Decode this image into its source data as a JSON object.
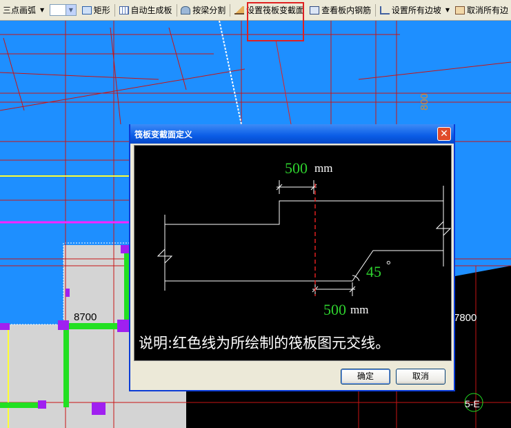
{
  "toolbar": {
    "arc_label": "三点画弧",
    "rect_label": "矩形",
    "auto_slab_label": "自动生成板",
    "split_beam_label": "按梁分割",
    "set_variable_section_label": "设置筏板变截面",
    "view_rebar_label": "查看板内钢筋",
    "set_all_slopes_label": "设置所有边坡",
    "cancel_all_label": "取消所有边"
  },
  "canvas": {
    "dim_left": "8700",
    "dim_right": "7800",
    "dim_top": "800",
    "axis_label": "5-E"
  },
  "dialog": {
    "title": "筏板变截面定义",
    "dim_top_value": "500",
    "dim_top_unit": "mm",
    "angle_value": "45",
    "angle_unit": "°",
    "dim_bottom_value": "500",
    "dim_bottom_unit": "mm",
    "note": "说明:红色线为所绘制的筏板图元交线。",
    "ok_label": "确定",
    "cancel_label": "取消"
  },
  "colors": {
    "canvas_blue": "#1e8fff",
    "slab_gray": "#d4d4d4",
    "beam_green": "#22e022",
    "column_purple": "#a020f0",
    "grid_red": "#c81414",
    "xp_blue": "#0a5ce6"
  }
}
